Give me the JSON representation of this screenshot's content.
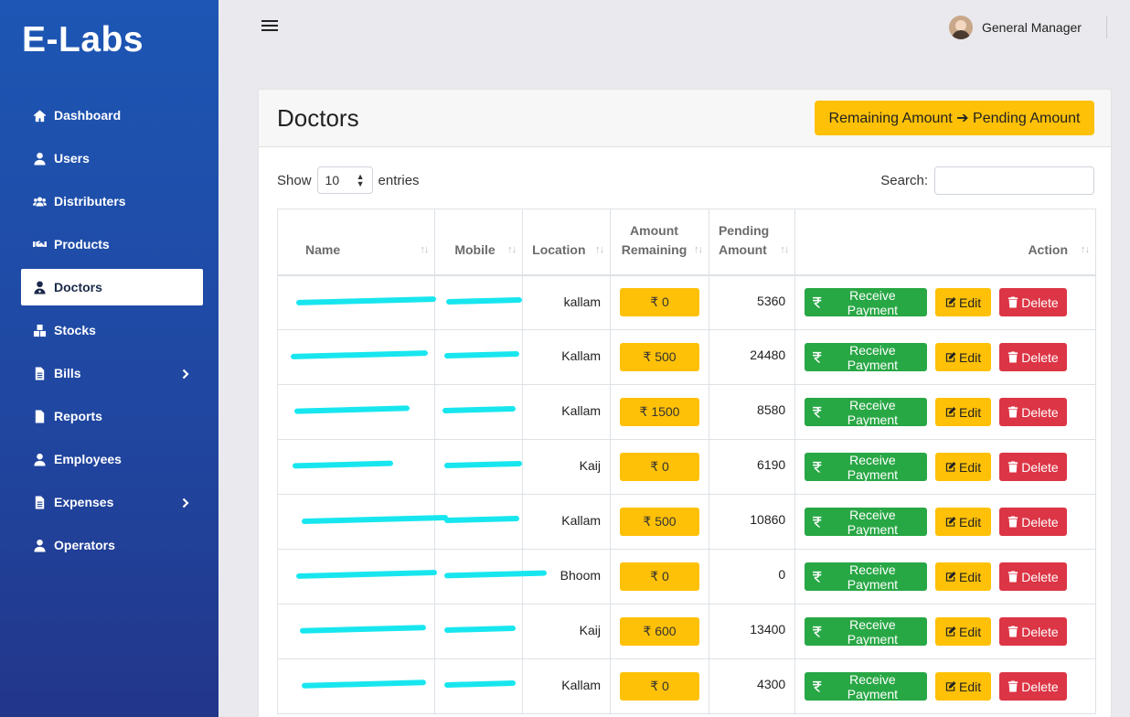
{
  "brand": "E-Labs",
  "sidebar": {
    "items": [
      {
        "label": "Dashboard",
        "icon": "home-icon",
        "active": false,
        "has_sub": false
      },
      {
        "label": "Users",
        "icon": "user-icon",
        "active": false,
        "has_sub": false
      },
      {
        "label": "Distributers",
        "icon": "users-group-icon",
        "active": false,
        "has_sub": false
      },
      {
        "label": "Products",
        "icon": "handshake-icon",
        "active": false,
        "has_sub": false
      },
      {
        "label": "Doctors",
        "icon": "user-doctor-icon",
        "active": true,
        "has_sub": false
      },
      {
        "label": "Stocks",
        "icon": "boxes-icon",
        "active": false,
        "has_sub": false
      },
      {
        "label": "Bills",
        "icon": "file-invoice-icon",
        "active": false,
        "has_sub": true
      },
      {
        "label": "Reports",
        "icon": "file-icon",
        "active": false,
        "has_sub": false
      },
      {
        "label": "Employees",
        "icon": "user-icon",
        "active": false,
        "has_sub": false
      },
      {
        "label": "Expenses",
        "icon": "file-invoice-icon",
        "active": false,
        "has_sub": true
      },
      {
        "label": "Operators",
        "icon": "user-icon",
        "active": false,
        "has_sub": false
      }
    ]
  },
  "topbar": {
    "user_name": "General Manager"
  },
  "card": {
    "title": "Doctors",
    "switch_button": "Remaining Amount ➔ Pending Amount"
  },
  "controls": {
    "show_label": "Show",
    "entries_value": "10",
    "entries_label": "entries",
    "search_label": "Search:"
  },
  "table": {
    "headers": {
      "name": "Name",
      "mobile": "Mobile",
      "location": "Location",
      "remaining": "Amount Remaining",
      "pending": "Pending Amount",
      "action": "Action"
    },
    "rows": [
      {
        "location": "kallam",
        "remaining": "₹ 0",
        "pending": "5360"
      },
      {
        "location": "Kallam",
        "remaining": "₹ 500",
        "pending": "24480"
      },
      {
        "location": "Kallam",
        "remaining": "₹ 1500",
        "pending": "8580"
      },
      {
        "location": "Kaij",
        "remaining": "₹ 0",
        "pending": "6190"
      },
      {
        "location": "Kallam",
        "remaining": "₹ 500",
        "pending": "10860"
      },
      {
        "location": "Bhoom",
        "remaining": "₹ 0",
        "pending": "0"
      },
      {
        "location": "Kaij",
        "remaining": "₹ 600",
        "pending": "13400"
      },
      {
        "location": "Kallam",
        "remaining": "₹ 0",
        "pending": "4300"
      }
    ],
    "actions": {
      "receive": "Receive Payment",
      "edit": "Edit",
      "delete": "Delete"
    }
  },
  "colors": {
    "sidebar_top": "#1d56b4",
    "sidebar_bottom": "#22368a",
    "warning": "#ffc107",
    "success": "#28a745",
    "danger": "#dc3545",
    "redaction": "#18e6ef"
  }
}
